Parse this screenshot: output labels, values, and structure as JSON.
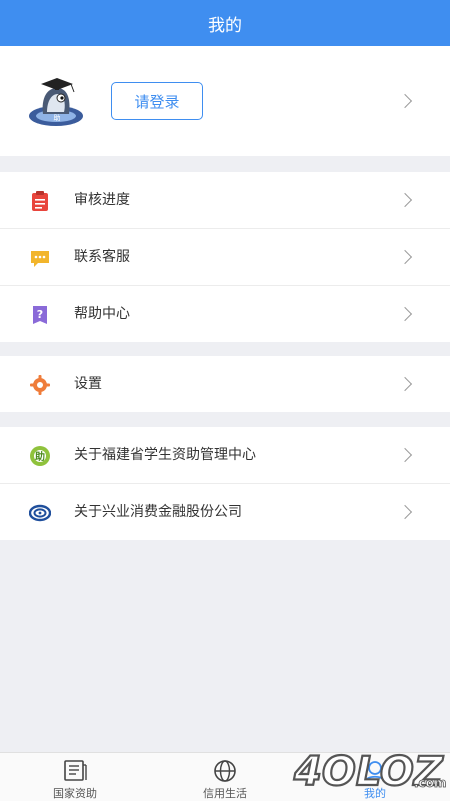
{
  "header": {
    "title": "我的"
  },
  "profile": {
    "login_label": "请登录"
  },
  "groups": [
    {
      "items": [
        {
          "label": "审核进度",
          "icon": "clipboard-icon"
        },
        {
          "label": "联系客服",
          "icon": "chat-icon"
        },
        {
          "label": "帮助中心",
          "icon": "help-icon"
        }
      ]
    },
    {
      "items": [
        {
          "label": "设置",
          "icon": "gear-icon"
        }
      ]
    },
    {
      "items": [
        {
          "label": "关于福建省学生资助管理中心",
          "icon": "fujian-aid-logo-icon"
        },
        {
          "label": "关于兴业消费金融股份公司",
          "icon": "cib-logo-icon"
        }
      ]
    }
  ],
  "tabs": [
    {
      "label": "国家资助",
      "icon": "news-icon",
      "active": false
    },
    {
      "label": "信用生活",
      "icon": "globe-icon",
      "active": false
    },
    {
      "label": "我的",
      "icon": "user-icon",
      "active": true
    }
  ],
  "colors": {
    "primary": "#3f8ef0",
    "background": "#eeeff3"
  },
  "watermark": {
    "text": "4OLOZ",
    "suffix": ".com"
  }
}
